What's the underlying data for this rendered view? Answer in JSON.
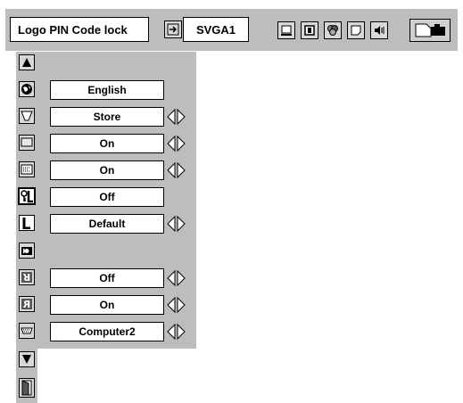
{
  "topbar": {
    "title": "Logo PIN Code lock",
    "source": "SVGA1",
    "icons": [
      "input-icon",
      "screen-icon",
      "image-icon",
      "color-icon",
      "setting-icon",
      "sound-icon",
      "projector-icon"
    ]
  },
  "menu": {
    "rows": [
      {
        "icon": "up-arrow-icon",
        "value": null,
        "arrows": false
      },
      {
        "icon": "globe-icon",
        "value": "English",
        "arrows": false
      },
      {
        "icon": "keystone-icon",
        "value": "Store",
        "arrows": true
      },
      {
        "icon": "blue-back-icon",
        "value": "On",
        "arrows": true
      },
      {
        "icon": "display-icon",
        "value": "On",
        "arrows": true
      },
      {
        "icon": "logo-pin-lock-icon",
        "value": "Off",
        "arrows": false
      },
      {
        "icon": "logo-select-icon",
        "value": "Default",
        "arrows": true
      },
      {
        "icon": "capture-icon",
        "value": null,
        "arrows": false
      },
      {
        "icon": "ceiling-icon",
        "value": "Off",
        "arrows": true
      },
      {
        "icon": "rear-icon",
        "value": "On",
        "arrows": true
      },
      {
        "icon": "terminal-icon",
        "value": "Computer2",
        "arrows": true
      },
      {
        "icon": "down-arrow-icon",
        "value": null,
        "arrows": false
      },
      {
        "icon": "exit-door-icon",
        "value": null,
        "arrows": false
      }
    ]
  }
}
